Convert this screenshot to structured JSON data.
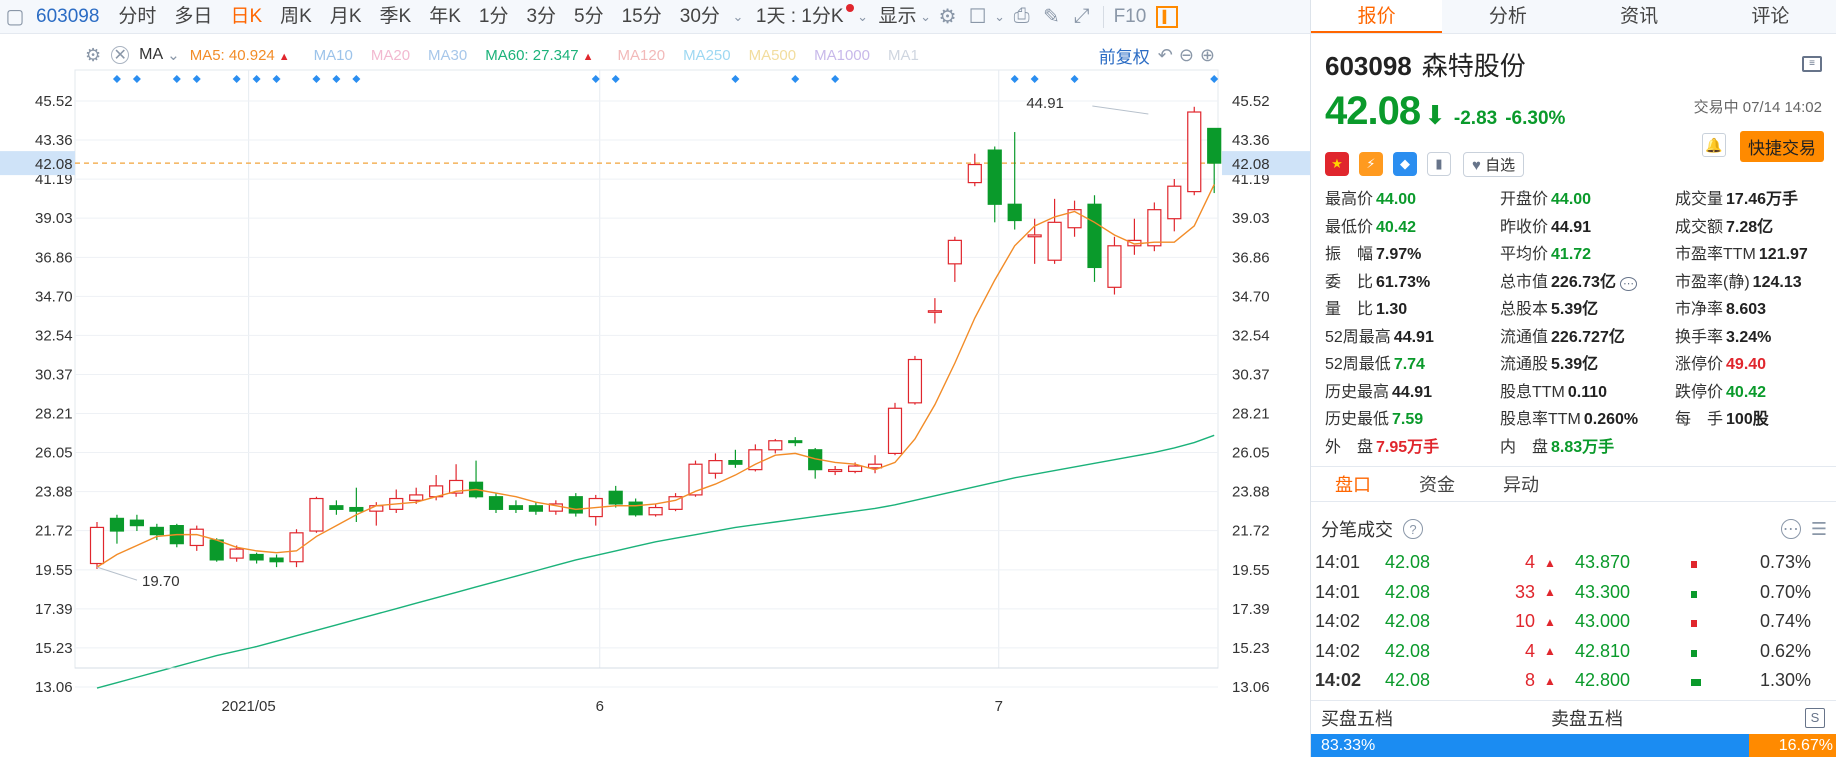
{
  "toolbar": {
    "code": "603098",
    "periods": [
      "分时",
      "多日",
      "日K",
      "周K",
      "月K",
      "季K",
      "年K",
      "1分",
      "3分",
      "5分",
      "15分",
      "30分"
    ],
    "active_period": "日K",
    "interval_select": "1天 : 1分K",
    "display_label": "显示",
    "f10_label": "F10"
  },
  "indicators": {
    "ma_label": "MA",
    "items": [
      {
        "text": "MA5: 40.924",
        "color": "#f28c28",
        "arrow": "▲"
      },
      {
        "text": "MA10",
        "color": "#9cc3ea",
        "arrow": ""
      },
      {
        "text": "MA20",
        "color": "#f2b9d0",
        "arrow": ""
      },
      {
        "text": "MA30",
        "color": "#a7c7ea",
        "arrow": ""
      },
      {
        "text": "MA60: 27.347",
        "color": "#1bb27a",
        "arrow": "▲"
      },
      {
        "text": "MA120",
        "color": "#f2b9b9",
        "arrow": ""
      },
      {
        "text": "MA250",
        "color": "#9ed8f2",
        "arrow": ""
      },
      {
        "text": "MA500",
        "color": "#f2dd9e",
        "arrow": ""
      },
      {
        "text": "MA1000",
        "color": "#c8b9ea",
        "arrow": ""
      },
      {
        "text": "MA1",
        "color": "#cfd6e0",
        "arrow": ""
      }
    ],
    "adjust_label": "前复权"
  },
  "chart_data": {
    "type": "candlestick",
    "y_ticks": [
      "45.52",
      "43.36",
      "41.19",
      "39.03",
      "36.86",
      "34.70",
      "32.54",
      "30.37",
      "28.21",
      "26.05",
      "23.88",
      "21.72",
      "19.55",
      "17.39",
      "15.23",
      "13.06"
    ],
    "ylim": [
      13.06,
      45.52
    ],
    "current_price": "42.08",
    "x_labels": [
      {
        "label": "2021/05",
        "index": 7.6
      },
      {
        "label": "6",
        "index": 25.2
      },
      {
        "label": "7",
        "index": 45.2
      }
    ],
    "annotations": [
      {
        "text": "44.91",
        "index": 53,
        "value": 44.91
      },
      {
        "text": "19.70",
        "index": 0,
        "value": 19.7
      }
    ],
    "candles": [
      {
        "o": 19.9,
        "c": 21.9,
        "h": 22.2,
        "l": 19.6
      },
      {
        "o": 22.4,
        "c": 21.7,
        "h": 22.6,
        "l": 21.0
      },
      {
        "o": 22.3,
        "c": 22.0,
        "h": 22.6,
        "l": 21.7
      },
      {
        "o": 21.9,
        "c": 21.5,
        "h": 22.1,
        "l": 21.2
      },
      {
        "o": 22.0,
        "c": 21.0,
        "h": 22.1,
        "l": 20.8
      },
      {
        "o": 20.9,
        "c": 21.8,
        "h": 22.0,
        "l": 20.6
      },
      {
        "o": 21.2,
        "c": 20.1,
        "h": 21.3,
        "l": 20.0
      },
      {
        "o": 20.2,
        "c": 20.7,
        "h": 20.9,
        "l": 20.0
      },
      {
        "o": 20.4,
        "c": 20.1,
        "h": 20.5,
        "l": 19.9
      },
      {
        "o": 20.2,
        "c": 20.0,
        "h": 20.4,
        "l": 19.7
      },
      {
        "o": 20.0,
        "c": 21.6,
        "h": 21.8,
        "l": 19.7
      },
      {
        "o": 21.7,
        "c": 23.5,
        "h": 23.6,
        "l": 21.6
      },
      {
        "o": 23.1,
        "c": 22.9,
        "h": 23.4,
        "l": 22.6
      },
      {
        "o": 23.0,
        "c": 22.8,
        "h": 24.1,
        "l": 22.2
      },
      {
        "o": 22.8,
        "c": 23.1,
        "h": 23.3,
        "l": 22.0
      },
      {
        "o": 22.9,
        "c": 23.5,
        "h": 24.0,
        "l": 22.7
      },
      {
        "o": 23.4,
        "c": 23.7,
        "h": 24.1,
        "l": 23.2
      },
      {
        "o": 23.6,
        "c": 24.2,
        "h": 24.8,
        "l": 23.4
      },
      {
        "o": 23.8,
        "c": 24.5,
        "h": 25.4,
        "l": 23.6
      },
      {
        "o": 24.4,
        "c": 23.6,
        "h": 25.6,
        "l": 23.5
      },
      {
        "o": 23.6,
        "c": 22.9,
        "h": 23.8,
        "l": 22.7
      },
      {
        "o": 23.1,
        "c": 22.9,
        "h": 23.4,
        "l": 22.7
      },
      {
        "o": 23.1,
        "c": 22.8,
        "h": 23.3,
        "l": 22.6
      },
      {
        "o": 22.8,
        "c": 23.2,
        "h": 23.4,
        "l": 22.6
      },
      {
        "o": 23.6,
        "c": 22.7,
        "h": 23.8,
        "l": 22.5
      },
      {
        "o": 22.5,
        "c": 23.5,
        "h": 23.7,
        "l": 22.0
      },
      {
        "o": 23.9,
        "c": 23.2,
        "h": 24.2,
        "l": 23.0
      },
      {
        "o": 23.3,
        "c": 22.6,
        "h": 23.5,
        "l": 22.5
      },
      {
        "o": 22.6,
        "c": 23.0,
        "h": 23.2,
        "l": 22.5
      },
      {
        "o": 22.9,
        "c": 23.6,
        "h": 23.8,
        "l": 22.8
      },
      {
        "o": 23.7,
        "c": 25.4,
        "h": 25.6,
        "l": 23.6
      },
      {
        "o": 24.9,
        "c": 25.6,
        "h": 26.0,
        "l": 24.6
      },
      {
        "o": 25.6,
        "c": 25.4,
        "h": 26.2,
        "l": 25.2
      },
      {
        "o": 25.1,
        "c": 26.2,
        "h": 26.5,
        "l": 25.0
      },
      {
        "o": 26.2,
        "c": 26.7,
        "h": 26.8,
        "l": 26.0
      },
      {
        "o": 26.7,
        "c": 26.6,
        "h": 26.9,
        "l": 26.4
      },
      {
        "o": 26.2,
        "c": 25.1,
        "h": 26.3,
        "l": 24.6
      },
      {
        "o": 25.0,
        "c": 25.1,
        "h": 25.3,
        "l": 24.8
      },
      {
        "o": 25.0,
        "c": 25.3,
        "h": 25.5,
        "l": 24.9
      },
      {
        "o": 25.2,
        "c": 25.4,
        "h": 25.9,
        "l": 24.9
      },
      {
        "o": 26.0,
        "c": 28.5,
        "h": 28.8,
        "l": 25.9
      },
      {
        "o": 28.8,
        "c": 31.2,
        "h": 31.4,
        "l": 28.7
      },
      {
        "o": 33.9,
        "c": 33.9,
        "h": 34.6,
        "l": 33.2
      },
      {
        "o": 36.5,
        "c": 37.8,
        "h": 38.0,
        "l": 35.5
      },
      {
        "o": 41.0,
        "c": 42.0,
        "h": 42.6,
        "l": 40.8
      },
      {
        "o": 42.8,
        "c": 39.8,
        "h": 43.0,
        "l": 38.8
      },
      {
        "o": 39.8,
        "c": 38.9,
        "h": 43.8,
        "l": 38.4
      },
      {
        "o": 38.0,
        "c": 38.1,
        "h": 39.0,
        "l": 36.5
      },
      {
        "o": 36.7,
        "c": 38.8,
        "h": 40.1,
        "l": 36.5
      },
      {
        "o": 38.5,
        "c": 39.5,
        "h": 40.0,
        "l": 38.0
      },
      {
        "o": 39.8,
        "c": 36.3,
        "h": 40.3,
        "l": 35.5
      },
      {
        "o": 35.2,
        "c": 37.5,
        "h": 38.0,
        "l": 34.8
      },
      {
        "o": 37.5,
        "c": 37.8,
        "h": 39.0,
        "l": 37.0
      },
      {
        "o": 37.5,
        "c": 39.5,
        "h": 39.9,
        "l": 37.2
      },
      {
        "o": 39.0,
        "c": 40.8,
        "h": 41.2,
        "l": 38.3
      },
      {
        "o": 40.5,
        "c": 44.91,
        "h": 45.2,
        "l": 40.3
      },
      {
        "o": 44.0,
        "c": 42.08,
        "h": 44.0,
        "l": 40.42
      }
    ],
    "ma5": [
      19.7,
      20.4,
      20.9,
      21.4,
      21.5,
      21.5,
      21.2,
      20.8,
      20.6,
      20.5,
      20.6,
      21.4,
      22.0,
      22.6,
      23.1,
      23.2,
      23.3,
      23.6,
      23.9,
      24.0,
      23.8,
      23.6,
      23.3,
      23.1,
      22.9,
      23.0,
      23.1,
      23.1,
      23.2,
      23.4,
      23.9,
      24.3,
      24.8,
      25.4,
      25.9,
      26.0,
      25.7,
      25.5,
      25.4,
      25.1,
      25.5,
      26.8,
      28.7,
      31.0,
      33.5,
      35.6,
      37.5,
      38.6,
      39.1,
      39.4,
      38.8,
      38.1,
      37.6,
      37.7,
      37.7,
      38.6,
      40.9
    ],
    "ma60": [
      13.0,
      13.3,
      13.6,
      13.9,
      14.2,
      14.5,
      14.8,
      15.05,
      15.3,
      15.6,
      15.9,
      16.2,
      16.5,
      16.8,
      17.1,
      17.4,
      17.7,
      18.0,
      18.3,
      18.6,
      18.9,
      19.2,
      19.5,
      19.8,
      20.1,
      20.35,
      20.6,
      20.85,
      21.1,
      21.3,
      21.5,
      21.7,
      21.9,
      22.05,
      22.2,
      22.35,
      22.5,
      22.65,
      22.8,
      22.95,
      23.15,
      23.4,
      23.65,
      23.9,
      24.15,
      24.4,
      24.65,
      24.85,
      25.05,
      25.25,
      25.45,
      25.65,
      25.85,
      26.05,
      26.3,
      26.6,
      27.0
    ]
  },
  "stock": {
    "code": "603098",
    "name": "森特股份",
    "price": "42.08",
    "arrow": "⬇",
    "change": "-2.83",
    "change_pct": "-6.30%",
    "trade_status": "交易中 07/14 14:02",
    "zixuan": "自选",
    "quick_trade": "快捷交易"
  },
  "quote_grid": [
    {
      "label": "最高价",
      "value": "44.00",
      "cls": "g"
    },
    {
      "label": "开盘价",
      "value": "44.00",
      "cls": "g"
    },
    {
      "label": "成交量",
      "value": "17.46万手",
      "cls": "k"
    },
    {
      "label": "最低价",
      "value": "40.42",
      "cls": "g"
    },
    {
      "label": "昨收价",
      "value": "44.91",
      "cls": "k"
    },
    {
      "label": "成交额",
      "value": "7.28亿",
      "cls": "k"
    },
    {
      "label": "振　幅",
      "value": "7.97%",
      "cls": "k"
    },
    {
      "label": "平均价",
      "value": "41.72",
      "cls": "g"
    },
    {
      "label": "市盈率TTM",
      "value": "121.97",
      "cls": "k"
    },
    {
      "label": "委　比",
      "value": "61.73%",
      "cls": "k"
    },
    {
      "label": "总市值",
      "value": "226.73亿",
      "cls": "k"
    },
    {
      "label": "市盈率(静)",
      "value": "124.13",
      "cls": "k"
    },
    {
      "label": "量　比",
      "value": "1.30",
      "cls": "k"
    },
    {
      "label": "总股本",
      "value": "5.39亿",
      "cls": "k"
    },
    {
      "label": "市净率",
      "value": "8.603",
      "cls": "k"
    },
    {
      "label": "52周最高",
      "value": "44.91",
      "cls": "k"
    },
    {
      "label": "流通值",
      "value": "226.727亿",
      "cls": "k"
    },
    {
      "label": "换手率",
      "value": "3.24%",
      "cls": "k"
    },
    {
      "label": "52周最低",
      "value": "7.74",
      "cls": "g"
    },
    {
      "label": "流通股",
      "value": "5.39亿",
      "cls": "k"
    },
    {
      "label": "涨停价",
      "value": "49.40",
      "cls": "r"
    },
    {
      "label": "历史最高",
      "value": "44.91",
      "cls": "k"
    },
    {
      "label": "股息TTM",
      "value": "0.110",
      "cls": "k"
    },
    {
      "label": "跌停价",
      "value": "40.42",
      "cls": "g"
    },
    {
      "label": "历史最低",
      "value": "7.59",
      "cls": "g"
    },
    {
      "label": "股息率TTM",
      "value": "0.260%",
      "cls": "k"
    },
    {
      "label": "每　手",
      "value": "100股",
      "cls": "k"
    },
    {
      "label": "外　盘",
      "value": "7.95万手",
      "cls": "r"
    },
    {
      "label": "内　盘",
      "value": "8.83万手",
      "cls": "g"
    },
    {
      "label": "",
      "value": "",
      "cls": "k"
    }
  ],
  "subtabs": [
    "盘口",
    "资金",
    "异动"
  ],
  "trades_title": "分笔成交",
  "trades": [
    {
      "time": "14:01",
      "price": "42.08",
      "vol": "4",
      "p2": "43.870",
      "pct": "0.73%",
      "mcolor": "#e0262d"
    },
    {
      "time": "14:01",
      "price": "42.08",
      "vol": "33",
      "p2": "43.300",
      "pct": "0.70%",
      "mcolor": "#0a9a2b"
    },
    {
      "time": "14:02",
      "price": "42.08",
      "vol": "10",
      "p2": "43.000",
      "pct": "0.74%",
      "mcolor": "#e0262d"
    },
    {
      "time": "14:02",
      "price": "42.08",
      "vol": "4",
      "p2": "42.810",
      "pct": "0.62%",
      "mcolor": "#0a9a2b"
    },
    {
      "time": "14:02",
      "price": "42.08",
      "vol": "8",
      "p2": "42.800",
      "pct": "1.30%",
      "mcolor": "#0a9a2b"
    }
  ],
  "buysell": {
    "buy": "买盘五档",
    "sell": "卖盘五档",
    "buy_pct": "83.33%",
    "sell_pct": "16.67%"
  }
}
